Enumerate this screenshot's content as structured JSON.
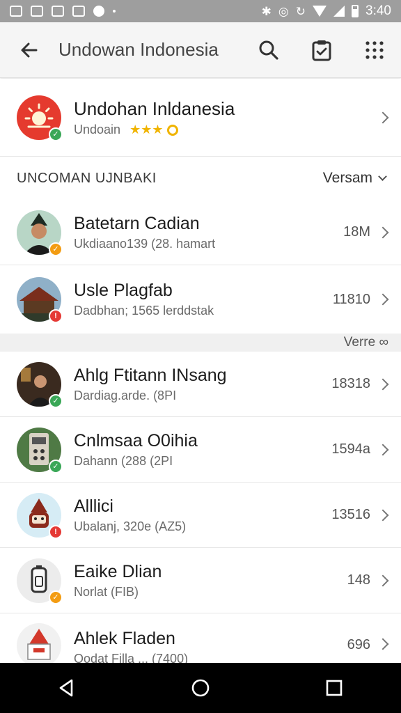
{
  "status_bar": {
    "time": "3:40"
  },
  "toolbar": {
    "title": "Undowan Indonesia",
    "icons": [
      "back-arrow-icon",
      "search-icon",
      "clipboard-icon",
      "grid-icon"
    ]
  },
  "app": {
    "title": "Undohan Inldanesia",
    "subtitle": "Undoain",
    "rating": "★★★",
    "badge_color": "#3aa757"
  },
  "section1": {
    "label": "UNCOMAN UJNBAKI",
    "sort_label": "Versam"
  },
  "items_a": [
    {
      "title": "Batetarn Cadian",
      "subtitle": "Ukdiaano139 (28. hamart",
      "value": "18M",
      "badge": "✓",
      "badge_color": "#f39c12",
      "bg": "#cfe3ee"
    },
    {
      "title": "Usle Plagfab",
      "subtitle": "Dadbhan; 1565 lerddstak",
      "value": "11810",
      "badge": "!",
      "badge_color": "#e53935",
      "bg": "#8d5c3c"
    }
  ],
  "strip_label": "Verre ∞",
  "items_b": [
    {
      "title": "Ahlg Ftitann INsang",
      "subtitle": "Dardiag.arde. (8PI",
      "value": "18318",
      "badge": "✓",
      "badge_color": "#3aa757",
      "bg": "#3a2a1f"
    },
    {
      "title": "Cnlmsaa O0ihia",
      "subtitle": "Dahann (288 (2PI",
      "value": "1594a",
      "badge": "✓",
      "badge_color": "#3aa757",
      "bg": "#4f7a45"
    },
    {
      "title": "Alllici",
      "subtitle": "Ubalanj, 320e (AZ5)",
      "value": "13516",
      "badge": "!",
      "badge_color": "#e53935",
      "bg": "#d6ecf5"
    },
    {
      "title": "Eaike Dlian",
      "subtitle": "Norlat (FIB)",
      "value": "148",
      "badge": "✓",
      "badge_color": "#f39c12",
      "bg": "#ececec"
    },
    {
      "title": "Ahlek Fladen",
      "subtitle": "Oodat Filla ... (7400)",
      "value": "696",
      "badge": "✓",
      "badge_color": "#3aa757",
      "bg": "#f1f1f1"
    }
  ]
}
